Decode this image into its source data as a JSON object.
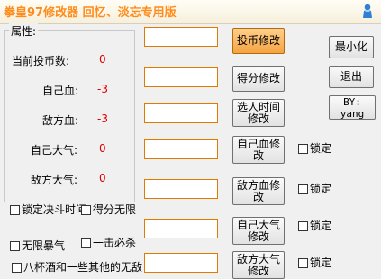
{
  "window": {
    "title": "拳皇97修改器  回忆、淡忘专用版",
    "icon": "figure-icon"
  },
  "attributes": {
    "group_label": "属性:",
    "rows": [
      {
        "label": "当前投币数:",
        "value": "0"
      },
      {
        "label": "自己血:",
        "value": "-3"
      },
      {
        "label": "敌方血:",
        "value": "-3"
      },
      {
        "label": "自己大气:",
        "value": "0"
      },
      {
        "label": "敌方大气:",
        "value": "0"
      }
    ]
  },
  "inputs": [
    "",
    "",
    "",
    "",
    "",
    "",
    "",
    ""
  ],
  "buttons": {
    "coin": "投币修改",
    "score": "得分修改",
    "time": "选人时间修改",
    "my_hp": "自己血修改",
    "enemy_hp": "敌方血修改",
    "my_power": "自己大气修改",
    "enemy_power": "敌方大气修改",
    "minimize": "最小化",
    "exit": "退出",
    "by": "BY: yang"
  },
  "lock_label": "锁定",
  "options": {
    "lock_timer": "锁定决斗时间",
    "infinite_score": "得分无限",
    "infinite_rage": "无限暴气",
    "one_hit_kill": "一击必杀",
    "yagami": "八杯酒和一些其他的无敌"
  }
}
